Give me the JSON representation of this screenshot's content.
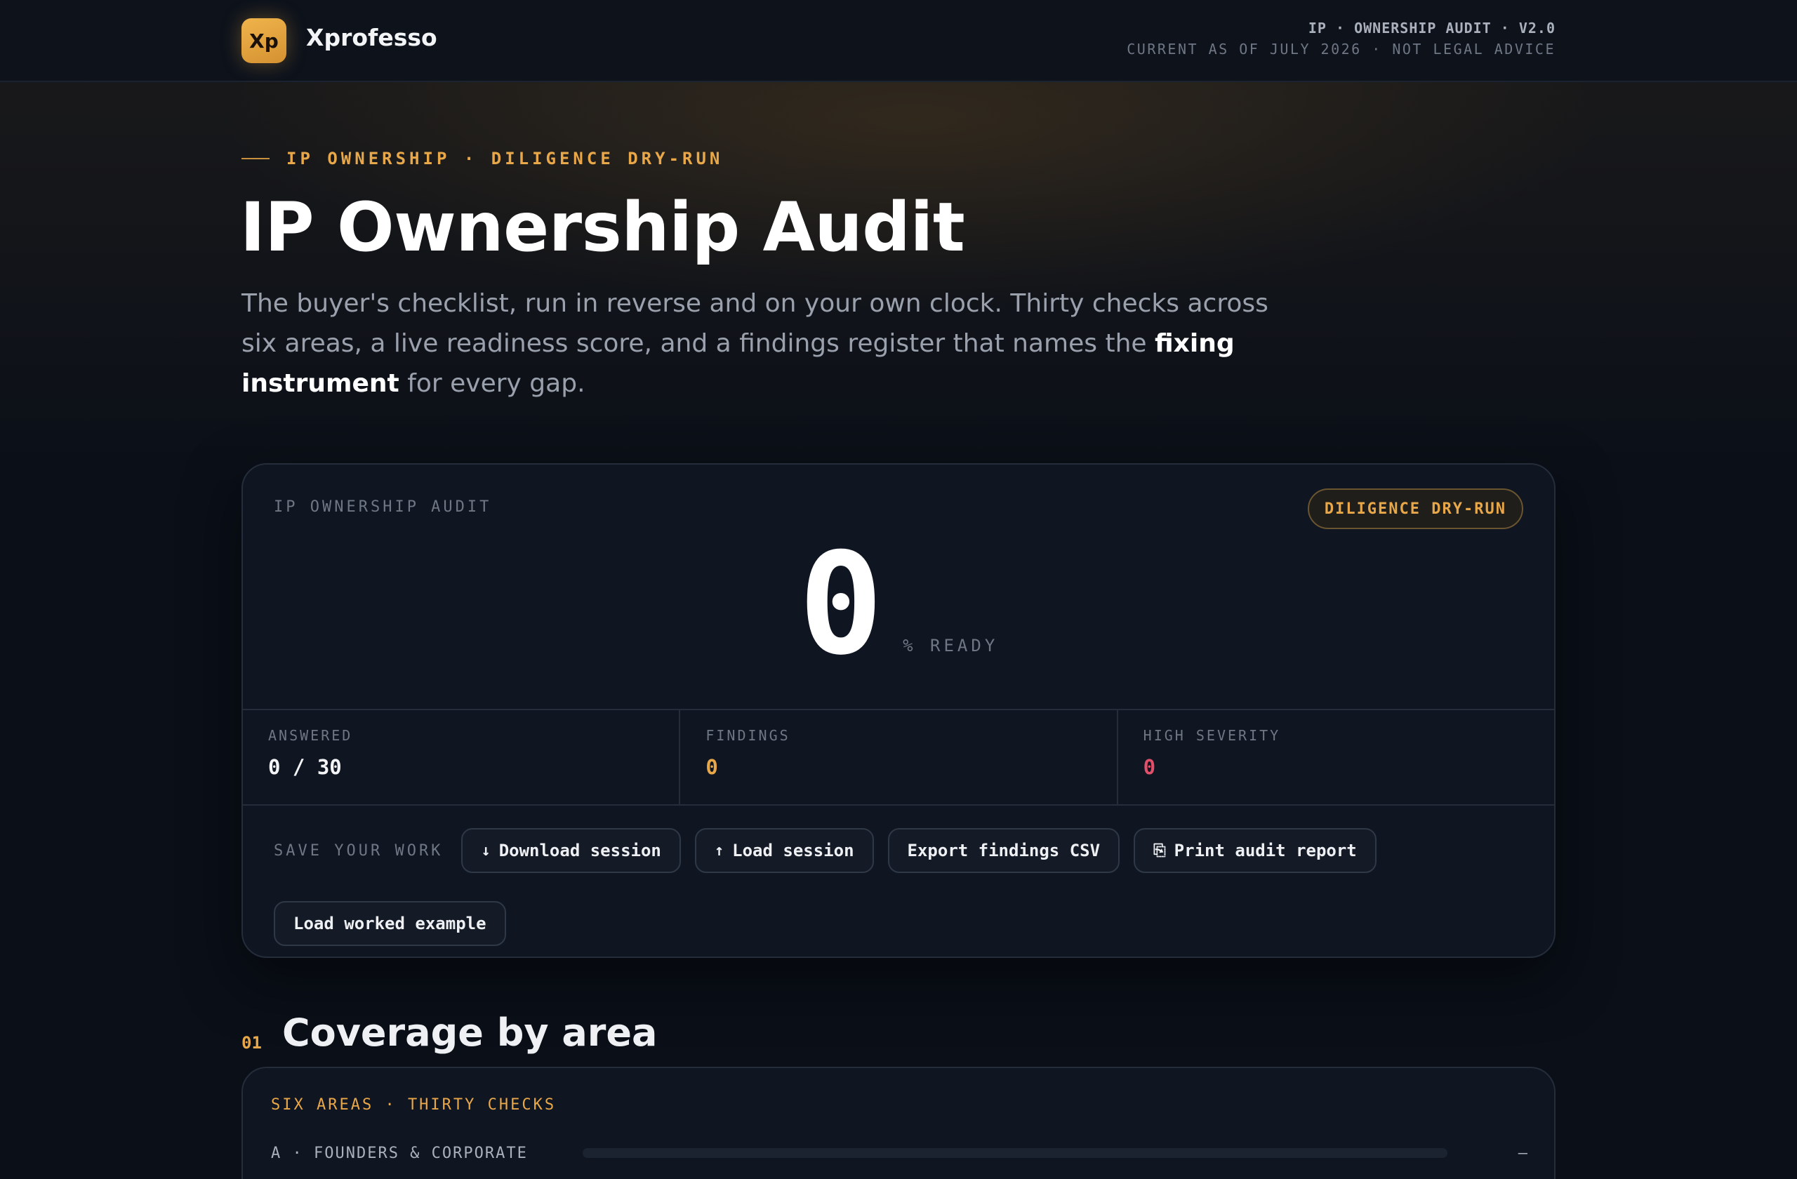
{
  "header": {
    "logo_text": "Xp",
    "brand": "Xprofesso",
    "meta_line1": "IP · OWNERSHIP AUDIT · V2.0",
    "meta_line2": "CURRENT AS OF JULY 2026 · NOT LEGAL ADVICE"
  },
  "hero": {
    "eyebrow": "IP OWNERSHIP · DILIGENCE DRY-RUN",
    "title": "IP Ownership Audit",
    "subtitle_before": "The buyer's checklist, run in reverse and on your own clock. Thirty checks across six areas, a live readiness score, and a findings register that names the ",
    "subtitle_bold": "fixing instrument",
    "subtitle_after": " for every gap."
  },
  "audit_card": {
    "label": "IP OWNERSHIP AUDIT",
    "pill": "DILIGENCE DRY-RUN",
    "score": "0",
    "score_unit": "% READY",
    "stats": [
      {
        "label": "ANSWERED",
        "value": "0 / 30",
        "color": "#f3f4f6"
      },
      {
        "label": "FINDINGS",
        "value": "0",
        "color": "#e8a84a"
      },
      {
        "label": "HIGH SEVERITY",
        "value": "0",
        "color": "#e0506a"
      }
    ],
    "save_label": "SAVE YOUR WORK",
    "buttons": {
      "download": {
        "icon": "↓",
        "label": "Download session"
      },
      "load": {
        "icon": "↑",
        "label": "Load session"
      },
      "export": {
        "label": "Export findings CSV"
      },
      "print": {
        "icon": "⎘",
        "label": "Print audit report"
      },
      "example": {
        "label": "Load worked example"
      }
    }
  },
  "coverage": {
    "number": "01",
    "title": "Coverage by area",
    "card_label": "SIX AREAS · THIRTY CHECKS",
    "areas": [
      {
        "name": "A · FOUNDERS & CORPORATE",
        "value": "—",
        "progress": 0
      }
    ]
  },
  "colors": {
    "accent": "#e8a84a",
    "danger": "#e0506a",
    "background": "#0a0f18",
    "card": "#0f1521"
  }
}
